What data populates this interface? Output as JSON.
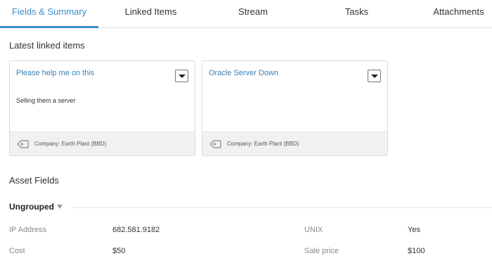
{
  "tabs": [
    {
      "label": "Fields & Summary"
    },
    {
      "label": "Linked Items"
    },
    {
      "label": "Stream"
    },
    {
      "label": "Tasks"
    },
    {
      "label": "Attachments"
    }
  ],
  "linked": {
    "title": "Latest linked items",
    "cards": [
      {
        "title": "Please help me on this",
        "description": "Selling them a server",
        "company": "Company: Earth Plant (BBD)"
      },
      {
        "title": "Oracle Server Down",
        "description": "",
        "company": "Company: Earth Plant (BBD)"
      }
    ]
  },
  "asset": {
    "title": "Asset Fields",
    "group": "Ungrouped",
    "fields": [
      {
        "label": "IP Address",
        "value": "682.581.9182"
      },
      {
        "label": "UNIX",
        "value": "Yes"
      },
      {
        "label": "Cost",
        "value": "$50"
      },
      {
        "label": "Sale price",
        "value": "$100"
      }
    ]
  }
}
